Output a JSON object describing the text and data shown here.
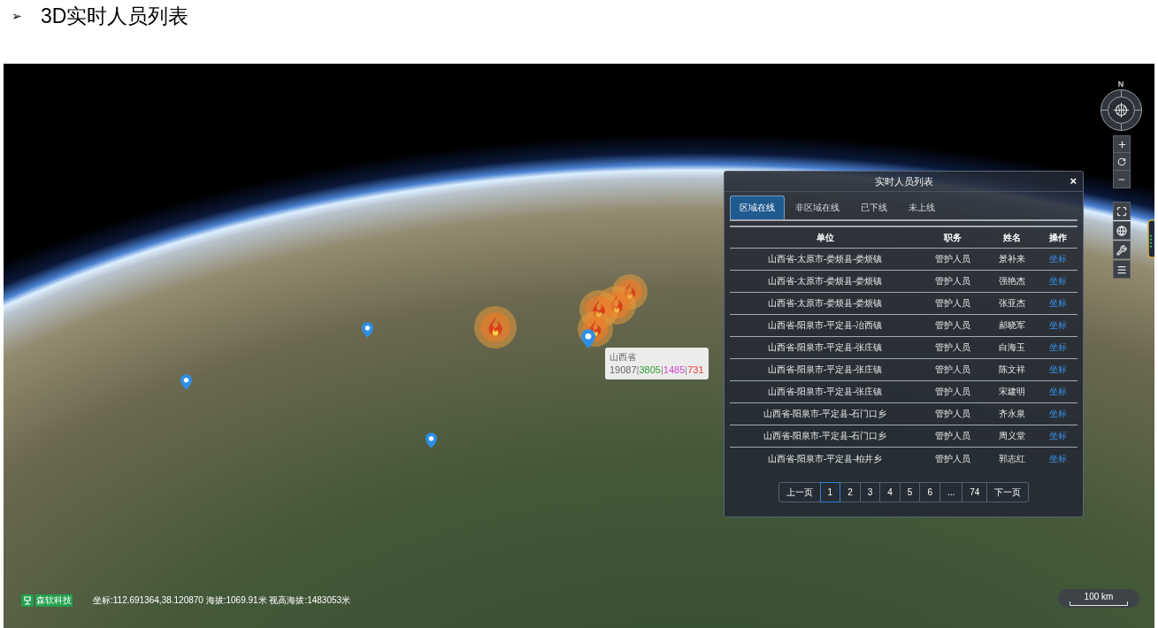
{
  "heading": {
    "bullet": "➢",
    "text": "3D实时人员列表"
  },
  "map": {
    "compass_label": "N",
    "tooltip": {
      "title": "山西省",
      "separator": "|",
      "counts": [
        {
          "text": "19087",
          "color": "#666666"
        },
        {
          "text": "3805",
          "color": "#2ca02c"
        },
        {
          "text": "1485",
          "color": "#d23fd2"
        },
        {
          "text": "731",
          "color": "#e53935"
        }
      ]
    },
    "branding": "森软科技",
    "coordinates": "坐标:112.691364,38.120870 海拔:1069.91米 视高海拔:1483053米",
    "scale": "100 km"
  },
  "panel": {
    "title": "实时人员列表",
    "close": "×",
    "tabs": [
      {
        "label": "区域在线",
        "selected": true
      },
      {
        "label": "非区域在线",
        "selected": false
      },
      {
        "label": "已下线",
        "selected": false
      },
      {
        "label": "未上线",
        "selected": false
      }
    ],
    "table": {
      "columns": [
        "单位",
        "职务",
        "姓名",
        "操作"
      ],
      "rows": [
        {
          "unit": "山西省-太原市-娄烦县-娄烦镇",
          "role": "管护人员",
          "name": "景补来",
          "action": "坐标"
        },
        {
          "unit": "山西省-太原市-娄烦县-娄烦镇",
          "role": "管护人员",
          "name": "强艳杰",
          "action": "坐标"
        },
        {
          "unit": "山西省-太原市-娄烦县-娄烦镇",
          "role": "管护人员",
          "name": "张亚杰",
          "action": "坐标"
        },
        {
          "unit": "山西省-阳泉市-平定县-冶西镇",
          "role": "管护人员",
          "name": "郝晓军",
          "action": "坐标"
        },
        {
          "unit": "山西省-阳泉市-平定县-张庄镇",
          "role": "管护人员",
          "name": "白海玉",
          "action": "坐标"
        },
        {
          "unit": "山西省-阳泉市-平定县-张庄镇",
          "role": "管护人员",
          "name": "陈文祥",
          "action": "坐标"
        },
        {
          "unit": "山西省-阳泉市-平定县-张庄镇",
          "role": "管护人员",
          "name": "宋建明",
          "action": "坐标"
        },
        {
          "unit": "山西省-阳泉市-平定县-石门口乡",
          "role": "管护人员",
          "name": "齐永泉",
          "action": "坐标"
        },
        {
          "unit": "山西省-阳泉市-平定县-石门口乡",
          "role": "管护人员",
          "name": "周义堂",
          "action": "坐标"
        },
        {
          "unit": "山西省-阳泉市-平定县-柏井乡",
          "role": "管护人员",
          "name": "郭志红",
          "action": "坐标"
        }
      ]
    },
    "pagination": [
      {
        "label": "上一页",
        "selected": false
      },
      {
        "label": "1",
        "selected": true
      },
      {
        "label": "2",
        "selected": false
      },
      {
        "label": "3",
        "selected": false
      },
      {
        "label": "4",
        "selected": false
      },
      {
        "label": "5",
        "selected": false
      },
      {
        "label": "6",
        "selected": false
      },
      {
        "label": "...",
        "selected": false
      },
      {
        "label": "74",
        "selected": false
      },
      {
        "label": "下一页",
        "selected": false
      }
    ]
  }
}
